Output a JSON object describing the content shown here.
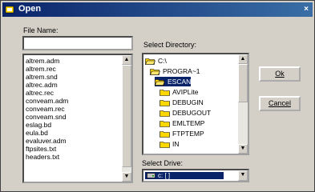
{
  "window": {
    "title": "Open",
    "close_glyph": "×"
  },
  "file_name": {
    "label": "File Name:",
    "value": "",
    "files": [
      "altrem.adm",
      "altrem.rec",
      "altrem.snd",
      "altrec.adm",
      "altrec.rec",
      "conveam.adm",
      "conveam.rec",
      "conveam.snd",
      "eslag.bd",
      "eula.bd",
      "evaluver.adm",
      "ftpsites.txt",
      "headers.txt"
    ]
  },
  "directory": {
    "label": "Select Directory:",
    "tree": [
      {
        "name": "C:\\",
        "level": 0,
        "open": true
      },
      {
        "name": "PROGRA~1",
        "level": 1,
        "open": true
      },
      {
        "name": "ESCAN",
        "level": 2,
        "open": true,
        "selected": true
      },
      {
        "name": "AVIPLite",
        "level": 3
      },
      {
        "name": "DEBUGIN",
        "level": 3
      },
      {
        "name": "DEBUGOUT",
        "level": 3
      },
      {
        "name": "EMLTEMP",
        "level": 3
      },
      {
        "name": "FTPTEMP",
        "level": 3
      },
      {
        "name": "IN",
        "level": 3
      }
    ]
  },
  "drive": {
    "label": "Select Drive:",
    "value": "c: [ ]"
  },
  "buttons": {
    "ok": "Ok",
    "cancel": "Cancel"
  },
  "icons": {
    "window": "app-icon",
    "folder_closed": "folder-icon",
    "folder_open": "folder-open-icon",
    "drive": "hard-drive-icon",
    "up": "arrow-up-icon",
    "down": "arrow-down-icon"
  },
  "colors": {
    "selection": "#0a246a",
    "folder": "#ffd800",
    "title_start": "#0a246a",
    "title_end": "#3a6ea5"
  }
}
